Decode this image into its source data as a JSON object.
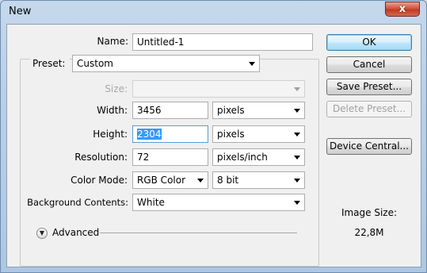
{
  "window": {
    "title": "New",
    "close_glyph": "x"
  },
  "form": {
    "name_label": "Name:",
    "name_value": "Untitled-1",
    "preset_label": "Preset:",
    "preset_value": "Custom",
    "size_label": "Size:",
    "size_value": "",
    "width_label": "Width:",
    "width_value": "3456",
    "width_unit": "pixels",
    "height_label": "Height:",
    "height_value": "2304",
    "height_unit": "pixels",
    "resolution_label": "Resolution:",
    "resolution_value": "72",
    "resolution_unit": "pixels/inch",
    "color_mode_label": "Color Mode:",
    "color_mode_value": "RGB Color",
    "bit_depth_value": "8 bit",
    "background_label": "Background Contents:",
    "background_value": "White",
    "advanced_label": "Advanced"
  },
  "buttons": {
    "ok": "OK",
    "cancel": "Cancel",
    "save_preset": "Save Preset...",
    "delete_preset": "Delete Preset...",
    "device_central": "Device Central..."
  },
  "image_size": {
    "label": "Image Size:",
    "value": "22,8M"
  },
  "icons": {
    "advanced_toggle": "double-chevron-down-icon",
    "dropdown": "triangle-down-icon",
    "close": "close-icon"
  },
  "colors": {
    "selection": "#3399ff",
    "default_button_border": "#3c7fb1",
    "close_button": "#c13a24"
  }
}
